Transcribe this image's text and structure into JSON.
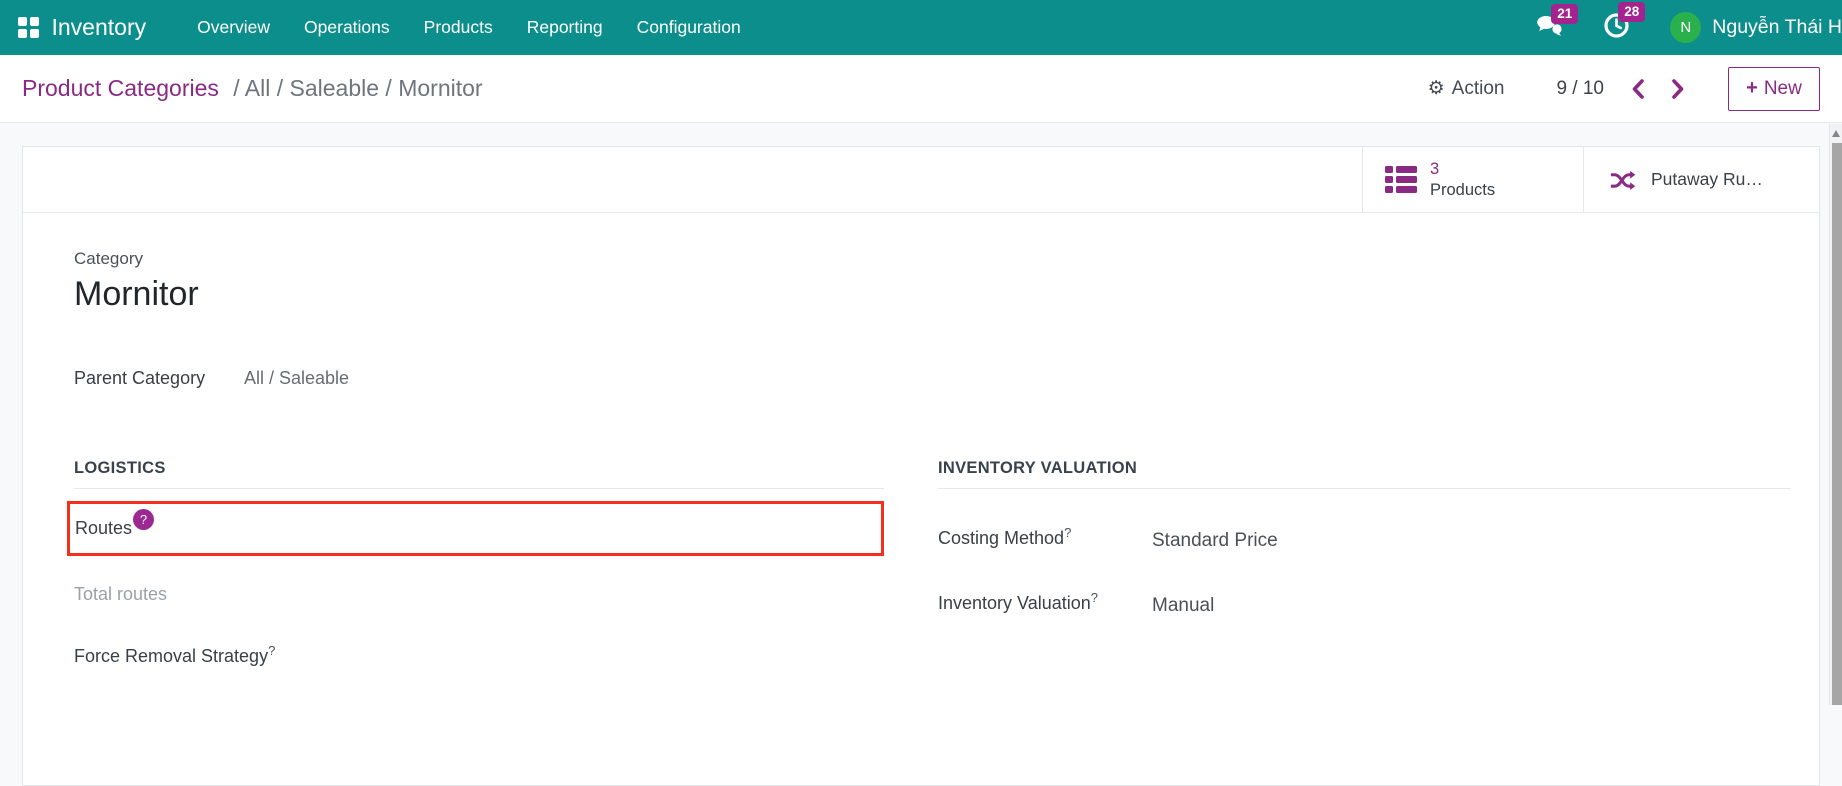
{
  "app": {
    "name": "Inventory",
    "menu": [
      "Overview",
      "Operations",
      "Products",
      "Reporting",
      "Configuration"
    ]
  },
  "topbar": {
    "messages_count": "21",
    "activities_count": "28",
    "user_initial": "N",
    "user_name": "Nguyễn Thái H"
  },
  "control_panel": {
    "breadcrumb_root": "Product Categories",
    "breadcrumb_path": "/ All / Saleable / Mornitor",
    "gear": "⚙",
    "action_label": "Action",
    "pager": "9 / 10",
    "new_plus": "+",
    "new_label": "New"
  },
  "smart_buttons": [
    {
      "count": "3",
      "label": "Products"
    },
    {
      "label": "Putaway Ru…"
    }
  ],
  "form": {
    "category_label": "Category",
    "category_name": "Mornitor",
    "parent_label": "Parent Category",
    "parent_value": "All / Saleable",
    "logistics": {
      "title": "LOGISTICS",
      "routes_label": "Routes",
      "routes_help": "?",
      "total_routes_label": "Total routes",
      "force_removal_label": "Force Removal Strategy",
      "force_removal_help": "?"
    },
    "valuation": {
      "title": "INVENTORY VALUATION",
      "costing_label": "Costing Method",
      "costing_help": "?",
      "costing_value": "Standard Price",
      "valuation_label": "Inventory Valuation",
      "valuation_help": "?",
      "valuation_value": "Manual"
    }
  },
  "colors": {
    "navbar_bg": "#0c8f8c",
    "accent_purple": "#8a2a83",
    "badge_bg": "#a3248f",
    "avatar_bg": "#2ab04c",
    "highlight_red": "#f2301d"
  }
}
